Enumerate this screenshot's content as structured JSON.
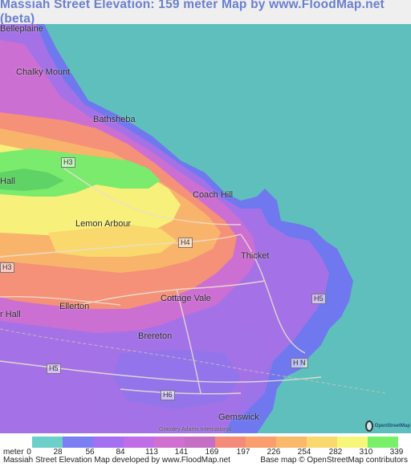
{
  "title": "Massiah Street Elevation: 159 meter Map by www.FloodMap.net (beta)",
  "map": {
    "places": [
      {
        "name": "Belleplaine"
      },
      {
        "name": "Chalky Mount"
      },
      {
        "name": "Bathsheba"
      },
      {
        "name": "Coach Hill"
      },
      {
        "name": "Hall"
      },
      {
        "name": "Lemon Arbour"
      },
      {
        "name": "Thicket"
      },
      {
        "name": "Cottage Vale"
      },
      {
        "name": "Ellerton"
      },
      {
        "name": "r Hall"
      },
      {
        "name": "Brereton"
      },
      {
        "name": "Gemswick"
      },
      {
        "name": "Grantley Adams International"
      }
    ],
    "roads": [
      "H3",
      "H4",
      "H3",
      "H5",
      "H5",
      "H N",
      "H6"
    ],
    "logo_text": "OpenStreetMap",
    "colors": {
      "sea": "#5ebfbd"
    }
  },
  "legend": {
    "unit_label": "meter",
    "ticks": [
      "0",
      "28",
      "56",
      "84",
      "113",
      "141",
      "169",
      "197",
      "226",
      "254",
      "282",
      "310",
      "339"
    ],
    "colors": [
      "#6ccfca",
      "#7b7ff2",
      "#a46ff0",
      "#c06ee7",
      "#d06fd0",
      "#c56ec3",
      "#f48b7a",
      "#f99e6c",
      "#fab86a",
      "#f9d96d",
      "#f6f67a",
      "#79f06a",
      "#79e873"
    ],
    "footer_left": "Massiah Street Elevation Map developed by www.FloodMap.net",
    "footer_right": "Base map © OpenStreetMap contributors"
  }
}
